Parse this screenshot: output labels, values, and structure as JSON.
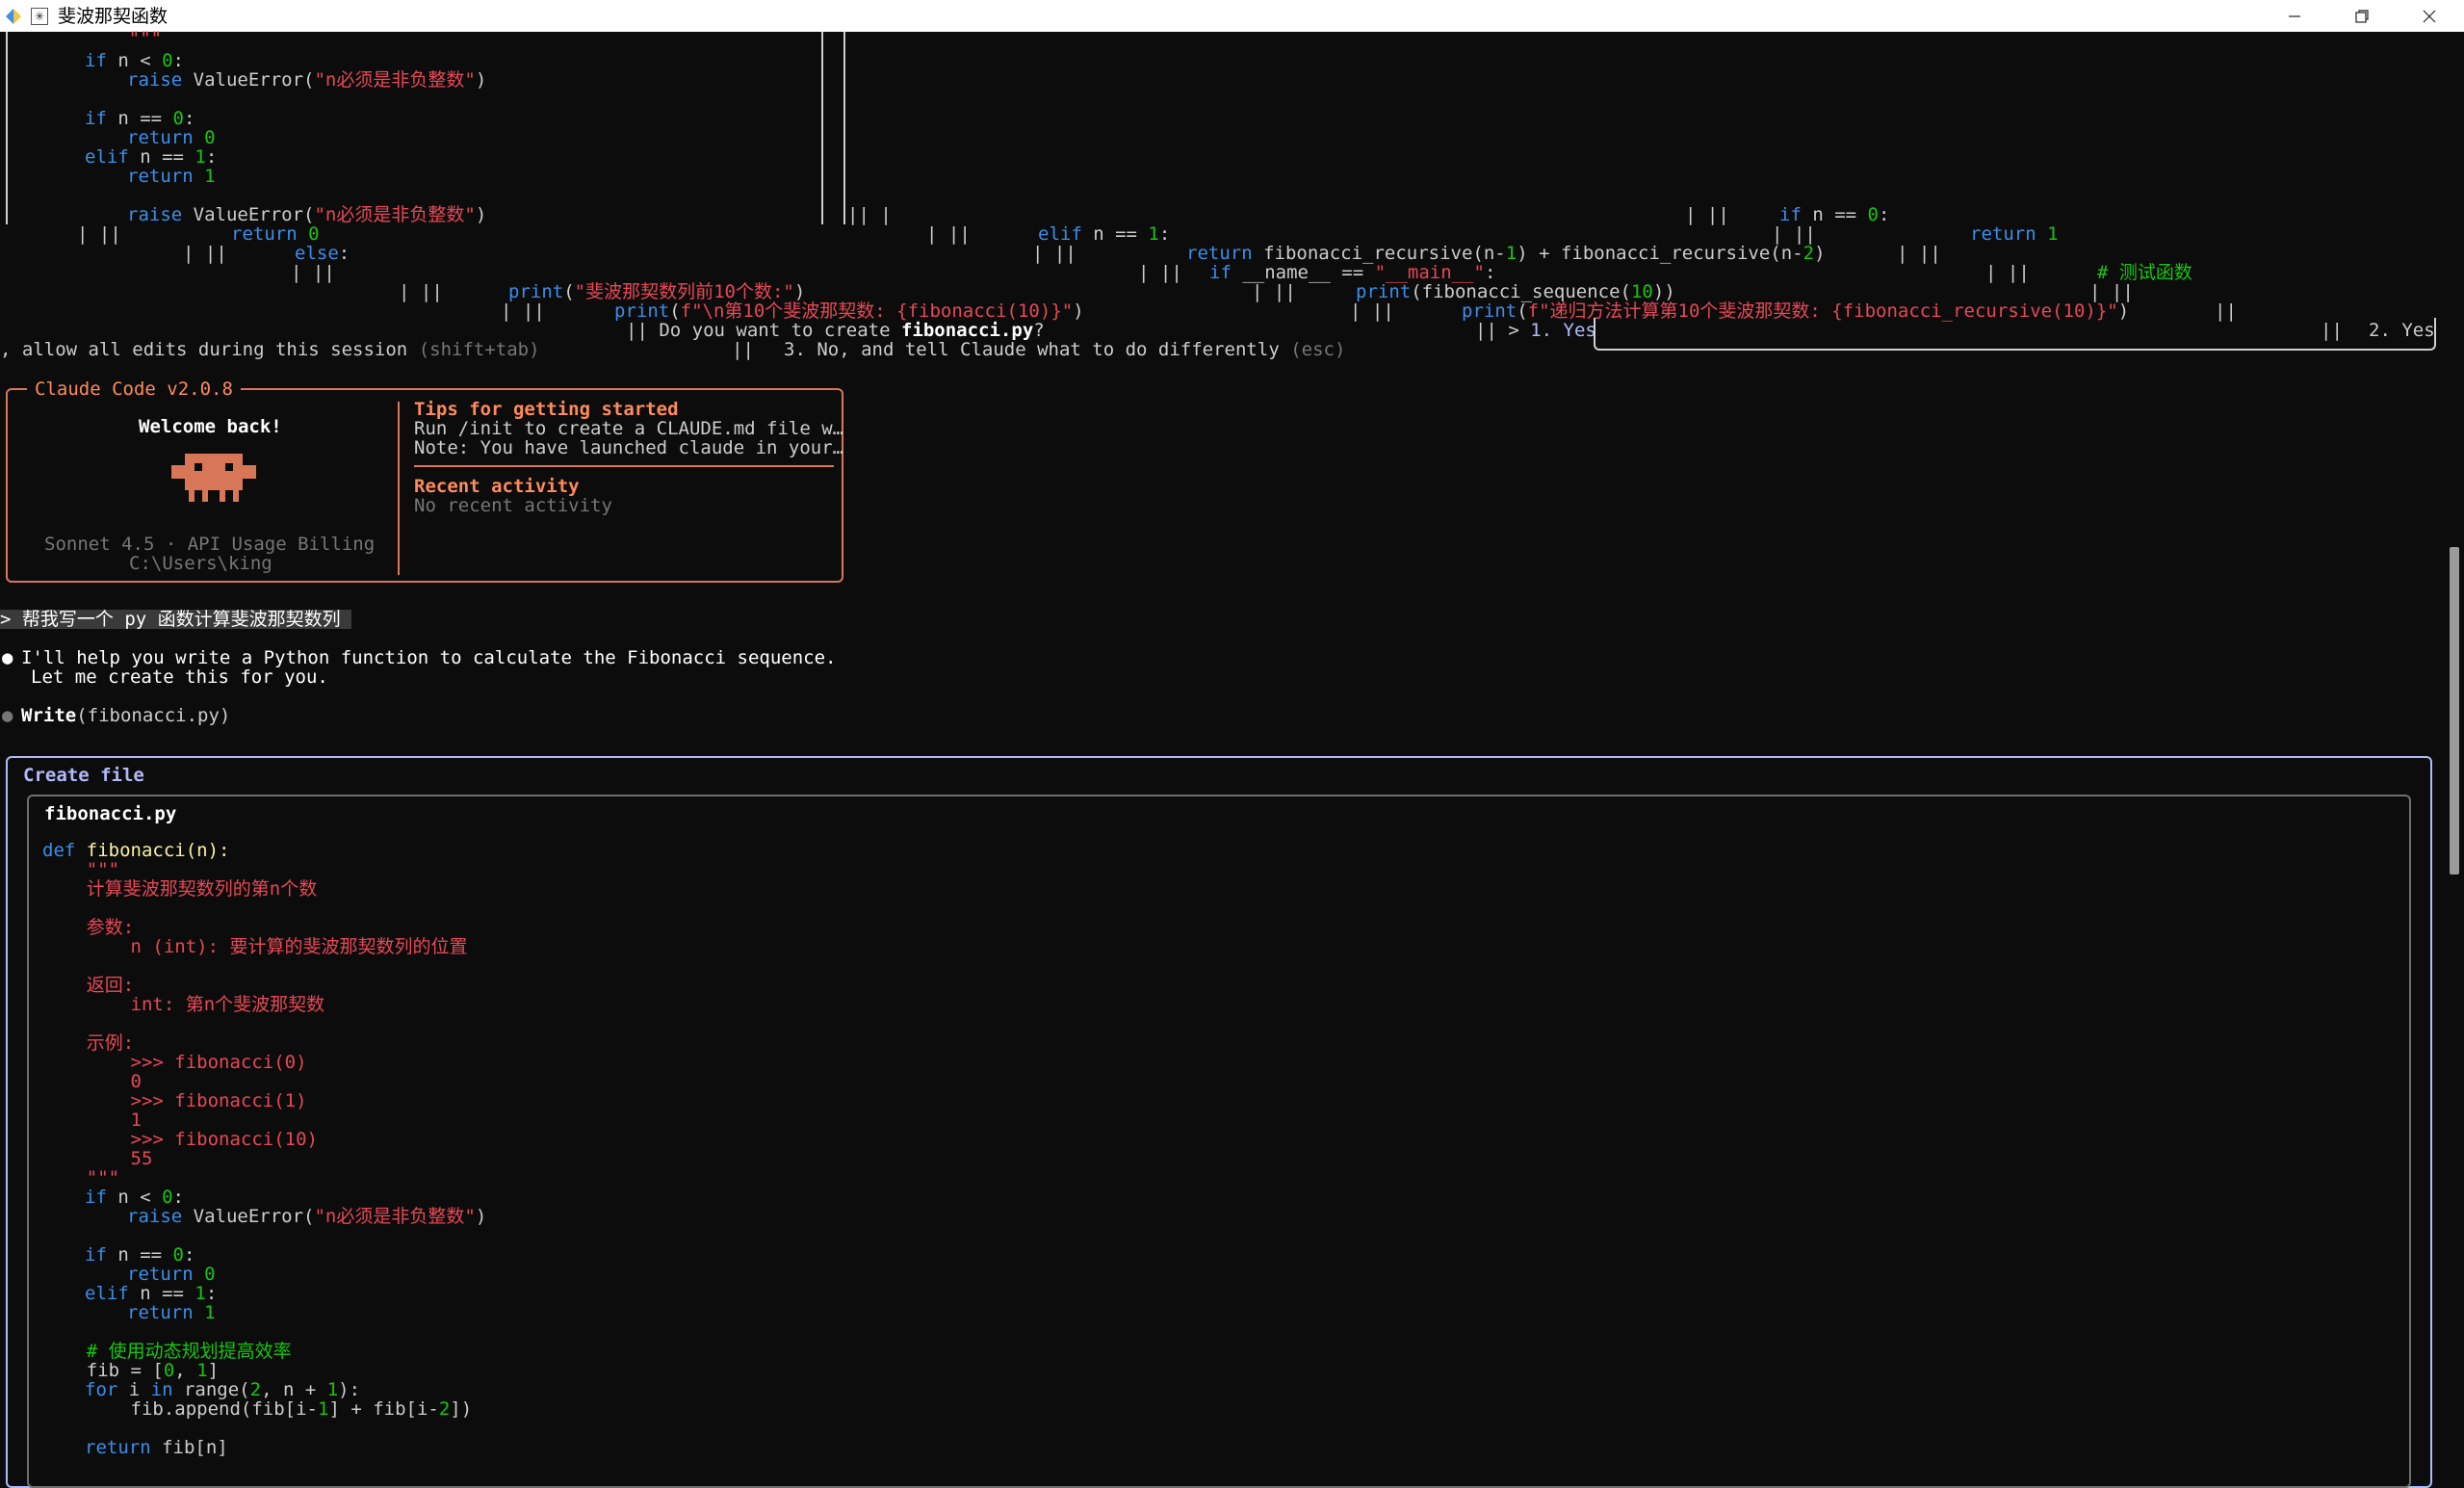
{
  "window": {
    "title": "斐波那契函数",
    "app_icon": "terminal-icon"
  },
  "top_code": {
    "l1": "    \"\"\"",
    "if1": "if",
    "if1b": " n < ",
    "if1n": "0",
    "if1c": ":",
    "raise1": "raise",
    "raise1b": " ValueError(",
    "raise1s": "\"n必须是非负整数\"",
    "raise1c": ")",
    "if2": "if",
    "if2b": " n == ",
    "if2n": "0",
    "if2c": ":",
    "ret0": "return",
    "ret0n": " 0",
    "elif1": "elif",
    "elif1b": " n == ",
    "elif1n": "1",
    "elif1c": ":",
    "ret1": "return",
    "ret1n": " 1"
  },
  "garbled": {
    "g1a": "raise",
    "g1b": " ValueError(",
    "g1s": "\"n必须是非负整数\"",
    "g1c": ")",
    "g1d": "|| |",
    "g1e": "| ||",
    "g1f": "if",
    "g1g": " n == ",
    "g1h": "0",
    "g1i": ":",
    "g2a": "| ||",
    "g2b": "return",
    "g2c": " 0",
    "g2d": "| ||",
    "g2e": "elif",
    "g2f": " n == ",
    "g2g": "1",
    "g2h": ":",
    "g2i": "| ||",
    "g2j": "return",
    "g2k": " 1",
    "g3a": "| ||",
    "g3b": "else",
    "g3c": ":",
    "g3d": "| ||",
    "g3e": "return",
    "g3f": " fibonacci_recursive(n-",
    "g3g": "1",
    "g3h": ") + fibonacci_recursive(n-",
    "g3i": "2",
    "g3j": ")",
    "g3k": "| ||",
    "g4a": "| ||",
    "g4b": "| ||",
    "g4c": "if",
    "g4d": " __name__ == ",
    "g4e": "\"__main__\"",
    "g4f": ":",
    "g4g": "| ||",
    "g4h": "# 测试函数",
    "g5a": "| ||",
    "g5b": "print",
    "g5c": "(",
    "g5d": "\"斐波那契数列前10个数:\"",
    "g5e": ")",
    "g5f": "| ||",
    "g5g": "print",
    "g5h": "(fibonacci_sequence(",
    "g5i": "10",
    "g5j": "))",
    "g5k": "| ||",
    "g6a": "| ||",
    "g6b": "print",
    "g6c": "(",
    "g6d": "f\"\\n第10个斐波那契数: {fibonacci(10)}\"",
    "g6e": ")",
    "g6f": "| ||",
    "g6g": "print",
    "g6h": "(",
    "g6i": "f\"递归方法计算第10个斐波那契数: {fibonacci_recursive(10)}\"",
    "g6j": ")",
    "g6k": "||",
    "g7a": "|| Do you want to create ",
    "g7b": "fibonacci.py",
    "g7c": "?",
    "g7d": "|| > ",
    "g7e": "1. Yes",
    "g7f": "||",
    "g7g": "2. Yes",
    "g8a": ", allow all edits during this session ",
    "g8b": "(shift+tab)",
    "g8c": "||",
    "g8d": "3. No, and tell Claude what to do differently ",
    "g8e": "(esc)"
  },
  "welcome": {
    "box_title": "Claude Code v2.0.8",
    "greeting": "Welcome back!",
    "model": "Sonnet 4.5 · API Usage Billing",
    "path": "C:\\Users\\king",
    "tips_title": "Tips for getting started",
    "tip1": "Run /init to create a CLAUDE.md file w…",
    "tip2": "Note: You have launched claude in your…",
    "recent_title": "Recent activity",
    "recent_text": "No recent activity"
  },
  "chat": {
    "user_prompt": "> 帮我写一个 py 函数计算斐波那契数列 ",
    "reply1": "I'll help you write a Python function to calculate the Fibonacci sequence.",
    "reply2": "Let me create this for you.",
    "tool_name": "Write",
    "tool_arg": "(fibonacci.py)"
  },
  "create_file": {
    "header": "Create file",
    "filename": "fibonacci.py",
    "c1a": "def",
    "c1b": " fibonacci(n):",
    "c2": "    \"\"\"",
    "c3": "    计算斐波那契数列的第n个数",
    "c5": "    参数:",
    "c6": "        n (int): 要计算的斐波那契数列的位置",
    "c8": "    返回:",
    "c9": "        int: 第n个斐波那契数",
    "c11": "    示例:",
    "c12": "        >>> fibonacci(0)",
    "c13": "        0",
    "c14": "        >>> fibonacci(1)",
    "c15": "        1",
    "c16": "        >>> fibonacci(10)",
    "c17": "        55",
    "c18": "    \"\"\"",
    "c19a": "if",
    "c19b": " n < ",
    "c19c": "0",
    "c19d": ":",
    "c20a": "raise",
    "c20b": " ValueError(",
    "c20c": "\"n必须是非负整数\"",
    "c20d": ")",
    "c22a": "if",
    "c22b": " n == ",
    "c22c": "0",
    "c22d": ":",
    "c23a": "return",
    "c23b": " 0",
    "c24a": "elif",
    "c24b": " n == ",
    "c24c": "1",
    "c24d": ":",
    "c25a": "return",
    "c25b": " 1",
    "c27": "    # 使用动态规划提高效率",
    "c28a": "    fib = [",
    "c28b": "0",
    "c28c": ", ",
    "c28d": "1",
    "c28e": "]",
    "c29a": "for",
    "c29b": " i ",
    "c29c": "in",
    "c29d": " range(",
    "c29e": "2",
    "c29f": ", n + ",
    "c29g": "1",
    "c29h": "):",
    "c30a": "        fib.append(fib[i-",
    "c30b": "1",
    "c30c": "] + fib[i-",
    "c30d": "2",
    "c30e": "])",
    "c32a": "return",
    "c32b": " fib[n]"
  },
  "colors": {
    "accent": "#d77757",
    "permission_box": "#b1b9f9",
    "background": "#0c0c0c"
  }
}
